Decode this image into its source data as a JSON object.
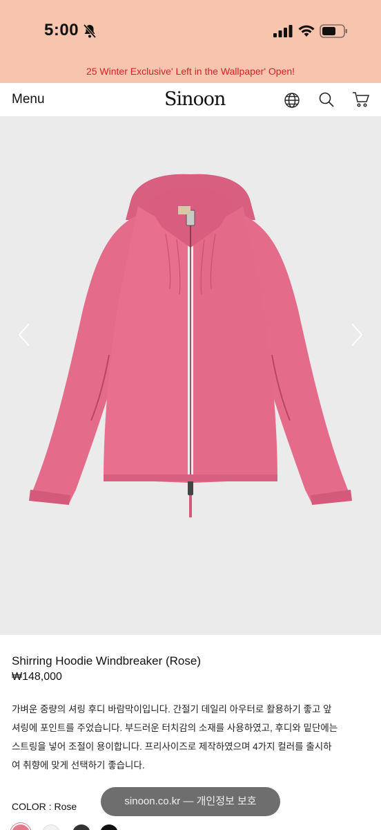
{
  "status_bar": {
    "time": "5:00",
    "icons": [
      "bell-slash-icon",
      "signal-icon",
      "wifi-icon",
      "battery-icon"
    ]
  },
  "promo": {
    "text": "25 Winter Exclusive' Left in the Wallpaper' Open!"
  },
  "header": {
    "menu_label": "Menu",
    "logo_text": "Sinoon",
    "icons": [
      "globe-icon",
      "search-icon",
      "cart-icon"
    ]
  },
  "gallery": {
    "image_subject": "pink hooded windbreaker jacket",
    "prev_icon": "chevron-left-icon",
    "next_icon": "chevron-right-icon"
  },
  "product": {
    "name": "Shirring Hoodie Windbreaker (Rose)",
    "price": "₩148,000",
    "description": "가벼운 중량의 셔링 후디 바람막이입니다. 간절기 데일리 아우터로 활용하기 좋고 앞\n셔링에 포인트를 주었습니다. 부드러운 터치감의 소재를 사용하였고, 후디와 밑단에는\n스트링을 넣어 조절이 용이합니다. 프리사이즈로 제작하였으며 4가지 컬러를 출시하\n여 취향에 맞게 선택하기 좋습니다.",
    "color_label": "COLOR : Rose",
    "swatch_colors": [
      "#e07a8a",
      "#f2f2f2",
      "#333333",
      "#111111"
    ]
  },
  "toast": {
    "text": "sinoon.co.kr — 개인정보 보호"
  },
  "colors": {
    "status_bg": "#f7c4ad",
    "promo_text": "#d4212a",
    "jacket": "#e56b8b",
    "gallery_bg": "#ebebeb"
  }
}
